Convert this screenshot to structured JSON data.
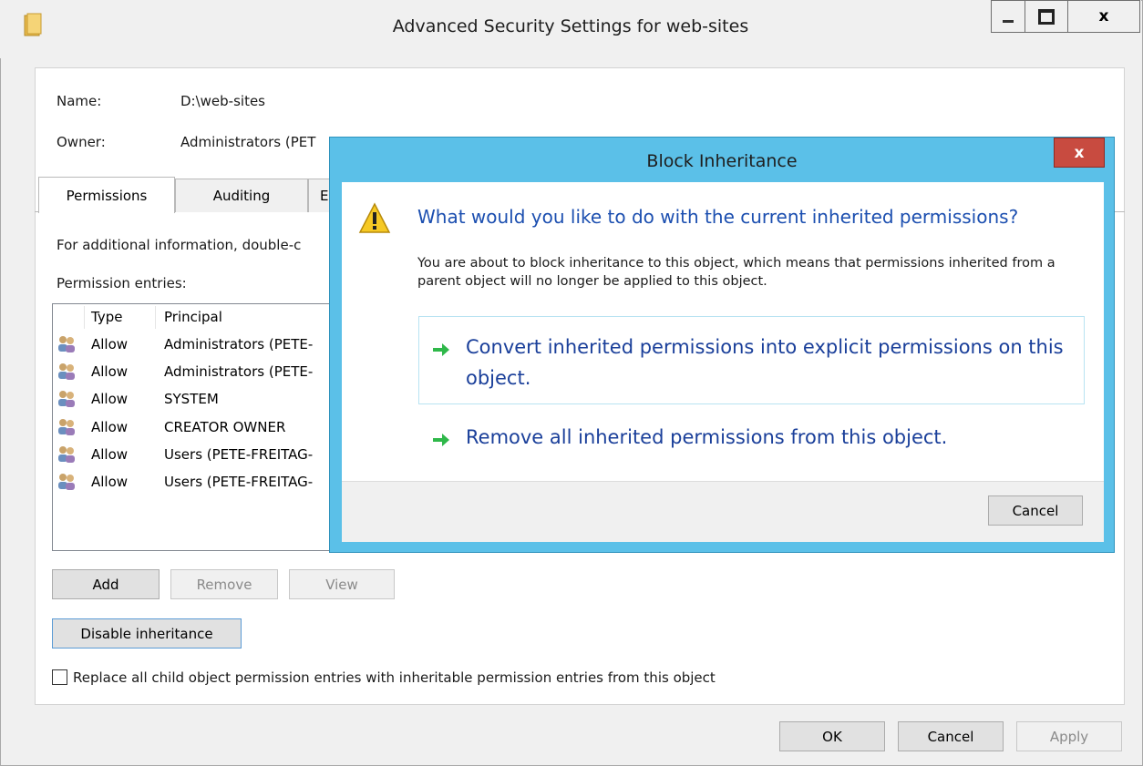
{
  "window": {
    "title": "Advanced Security Settings for web-sites"
  },
  "info": {
    "name_label": "Name:",
    "name_value": "D:\\web-sites",
    "owner_label": "Owner:",
    "owner_value": "Administrators (PET"
  },
  "tabs": [
    {
      "label": "Permissions"
    },
    {
      "label": "Auditing"
    },
    {
      "label": "E"
    }
  ],
  "info_text": "For additional information, double-c",
  "perm_entries_label": "Permission entries:",
  "table": {
    "headers": [
      "Type",
      "Principal"
    ],
    "rows": [
      {
        "type": "Allow",
        "principal": "Administrators (PETE-"
      },
      {
        "type": "Allow",
        "principal": "Administrators (PETE-"
      },
      {
        "type": "Allow",
        "principal": "SYSTEM"
      },
      {
        "type": "Allow",
        "principal": "CREATOR OWNER"
      },
      {
        "type": "Allow",
        "principal": "Users (PETE-FREITAG-"
      },
      {
        "type": "Allow",
        "principal": "Users (PETE-FREITAG-"
      }
    ]
  },
  "buttons": {
    "add": "Add",
    "remove": "Remove",
    "view": "View",
    "disable_inheritance": "Disable inheritance",
    "ok": "OK",
    "cancel": "Cancel",
    "apply": "Apply"
  },
  "replace_checkbox_label": "Replace all child object permission entries with inheritable permission entries from this object",
  "dialog": {
    "title": "Block Inheritance",
    "close": "x",
    "heading": "What would you like to do with the current inherited permissions?",
    "description": "You are about to block inheritance to this object, which means that permissions inherited from a parent object will no longer be applied to this object.",
    "option1": "Convert inherited permissions into explicit permissions on this object.",
    "option2": "Remove all inherited permissions from this object.",
    "cancel": "Cancel"
  },
  "caption_buttons": {
    "minimize": "—",
    "maximize": "□",
    "close": "x"
  },
  "colors": {
    "dialog_frame": "#5bc0e8",
    "close_red": "#c84b40",
    "link_blue": "#1c4fb0",
    "arrow_green": "#2fb84a"
  }
}
